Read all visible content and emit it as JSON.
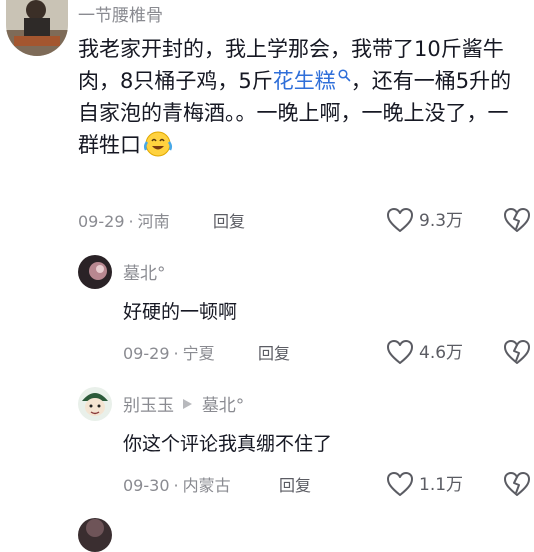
{
  "comments": [
    {
      "username": "一节腰椎骨",
      "text_parts": [
        "我老家开封的，我上学那会，我带了10斤酱牛肉，8只桶子鸡，5斤",
        "花生糕",
        "，还有一桶5升的自家泡的青梅酒。。一晚上啊，一晚上没了，一群牲口"
      ],
      "date": "09-29",
      "location": "河南",
      "reply_label": "回复",
      "likes": "9.3万"
    },
    {
      "username": "墓北°",
      "text": "好硬的一顿啊",
      "date": "09-29",
      "location": "宁夏",
      "reply_label": "回复",
      "likes": "4.6万"
    },
    {
      "username": "别玉玉",
      "reply_to": "墓北°",
      "text": "你这个评论我真绷不住了",
      "date": "09-30",
      "location": "内蒙古",
      "reply_label": "回复",
      "likes": "1.1万"
    }
  ],
  "icons": {
    "like": "heart-outline-icon",
    "dislike": "broken-heart-icon",
    "search": "search-icon",
    "arrow": "right-triangle-icon",
    "emoji": "crying-laughing-emoji-icon"
  },
  "colors": {
    "text": "#161823",
    "meta": "#8a8b91",
    "link": "#2f6fd9"
  }
}
